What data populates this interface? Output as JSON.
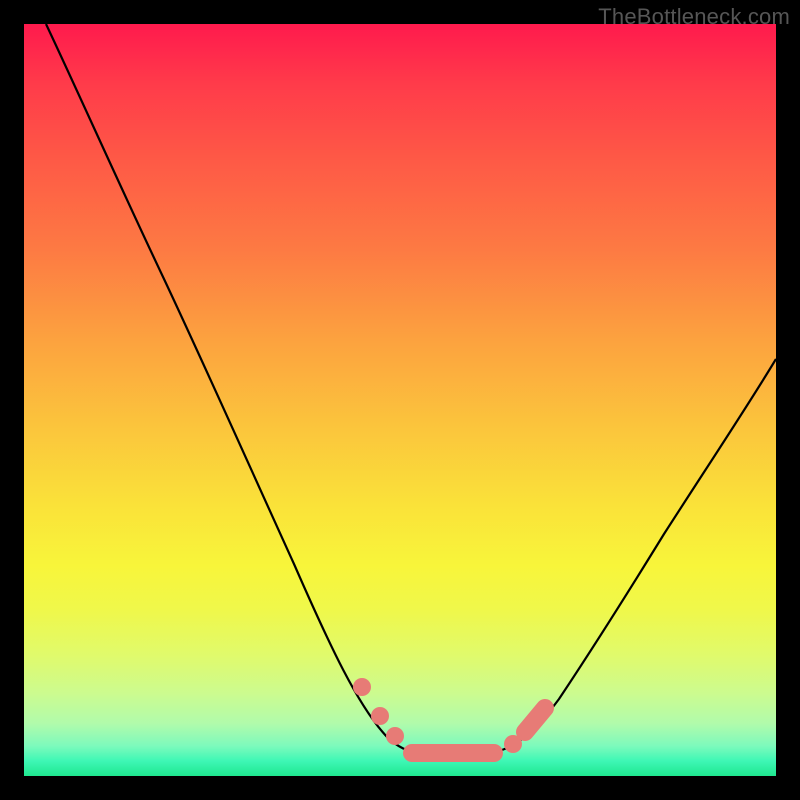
{
  "watermark": "TheBottleneck.com",
  "chart_data": {
    "type": "line",
    "title": "",
    "xlabel": "",
    "ylabel": "",
    "xlim": [
      0,
      100
    ],
    "ylim": [
      0,
      100
    ],
    "grid": false,
    "legend": false,
    "background_gradient": {
      "top": "#ff1a4d",
      "mid_upper": "#fd7a43",
      "mid": "#fbc63c",
      "mid_lower": "#f8f53a",
      "bottom": "#1fe88f"
    },
    "series": [
      {
        "name": "bottleneck-curve",
        "description": "V-shaped curve: steep descent from top-left to a flat trough around x≈52–64 at y≈3, then rising toward upper right (ending near y≈57).",
        "x": [
          3,
          8,
          14,
          20,
          26,
          32,
          38,
          43,
          47,
          50,
          53,
          56,
          59,
          62,
          65,
          68,
          72,
          78,
          85,
          92,
          100
        ],
        "y": [
          100,
          88,
          75,
          63,
          50,
          38,
          26,
          16,
          9,
          5,
          3,
          3,
          3,
          3,
          4,
          7,
          12,
          21,
          32,
          45,
          57
        ]
      }
    ],
    "markers": {
      "description": "Pink/salmon rounded markers along the trough and short ascent segments of the curve",
      "points": [
        {
          "x": 45,
          "y": 12
        },
        {
          "x": 48,
          "y": 7
        },
        {
          "x": 50.5,
          "y": 4.5
        },
        {
          "x": 65.5,
          "y": 4.5
        },
        {
          "x": 67.5,
          "y": 7
        },
        {
          "x": 70,
          "y": 10
        }
      ],
      "trough_segment": {
        "x_from": 52,
        "x_to": 64,
        "y": 3
      }
    }
  }
}
